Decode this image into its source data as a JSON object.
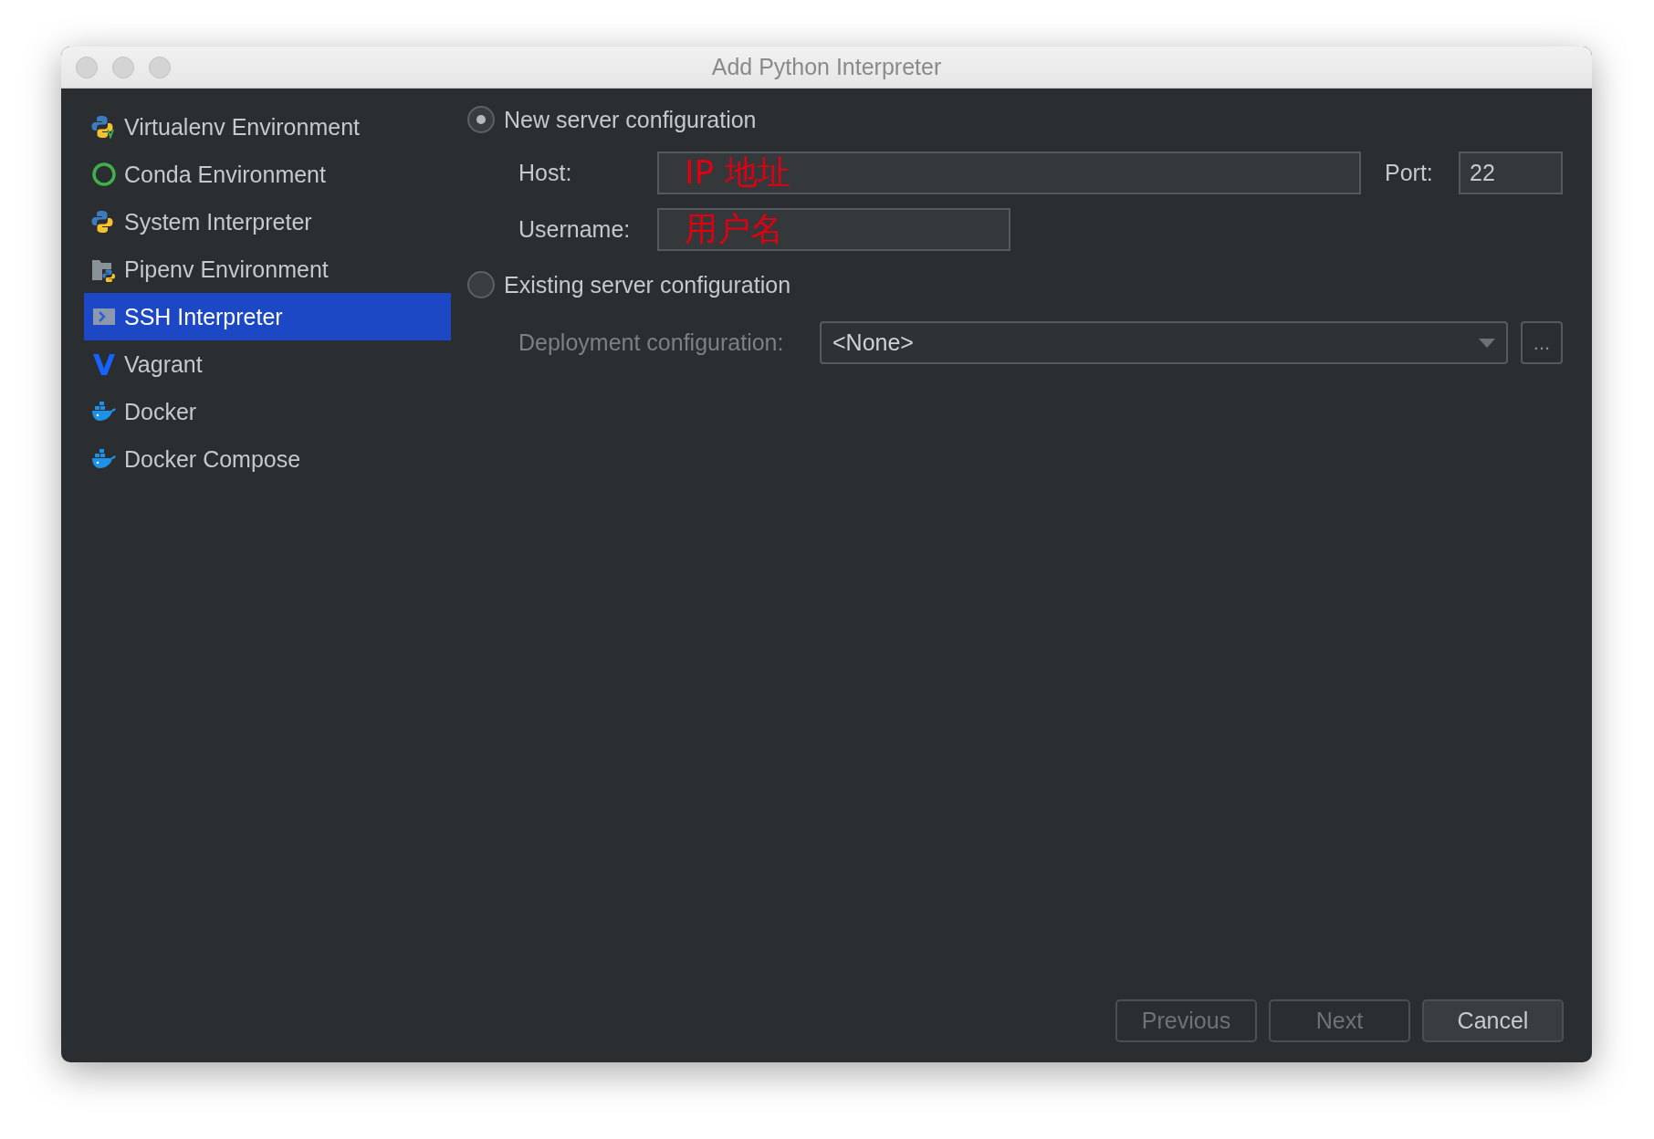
{
  "window": {
    "title": "Add Python Interpreter"
  },
  "sidebar": {
    "items": [
      {
        "label": "Virtualenv Environment",
        "kind": "virtualenv",
        "selected": false
      },
      {
        "label": "Conda Environment",
        "kind": "conda",
        "selected": false
      },
      {
        "label": "System Interpreter",
        "kind": "python",
        "selected": false
      },
      {
        "label": "Pipenv Environment",
        "kind": "pipenv",
        "selected": false
      },
      {
        "label": "SSH Interpreter",
        "kind": "ssh",
        "selected": true
      },
      {
        "label": "Vagrant",
        "kind": "vagrant",
        "selected": false
      },
      {
        "label": "Docker",
        "kind": "docker",
        "selected": false
      },
      {
        "label": "Docker Compose",
        "kind": "docker",
        "selected": false
      }
    ]
  },
  "new_server": {
    "label": "New server configuration",
    "selected": true,
    "host": {
      "label": "Host:",
      "value": "IP 地址"
    },
    "port": {
      "label": "Port:",
      "value": "22"
    },
    "username": {
      "label": "Username:",
      "value": "用户名"
    }
  },
  "existing_server": {
    "label": "Existing server configuration",
    "selected": false,
    "deployment": {
      "label": "Deployment configuration:",
      "value": "<None>",
      "disabled": true,
      "browse": "..."
    }
  },
  "buttons": [
    {
      "label": "Previous",
      "disabled": true
    },
    {
      "label": "Next",
      "disabled": true
    },
    {
      "label": "Cancel",
      "disabled": false
    }
  ]
}
